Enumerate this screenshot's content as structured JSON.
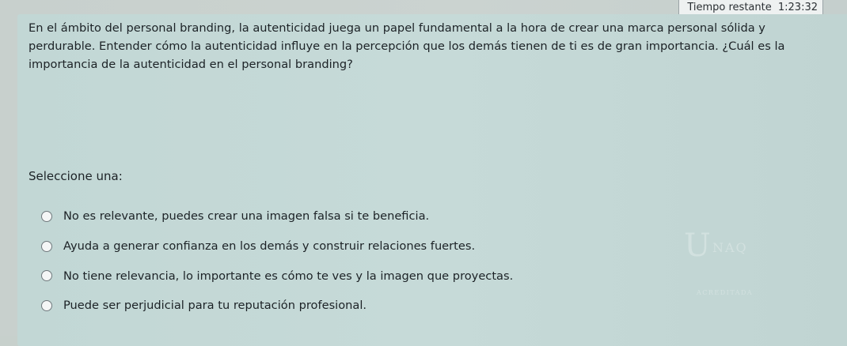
{
  "timer": {
    "label": "Tiempo restante",
    "value": "1:23:32"
  },
  "question": {
    "text": "En el ámbito del personal branding, la autenticidad juega un papel fundamental a la hora de crear una marca personal sólida y perdurable. Entender cómo la autenticidad influye en la percepción que los demás tienen de ti es de gran importancia. ¿Cuál es la importancia de la autenticidad en el personal branding?",
    "prompt": "Seleccione una:",
    "options": [
      {
        "label": "No es relevante, puedes crear una imagen falsa si te beneficia."
      },
      {
        "label": "Ayuda a generar confianza en los demás y construir relaciones fuertes."
      },
      {
        "label": "No tiene relevancia, lo importante es cómo te ves y la imagen que proyectas."
      },
      {
        "label": "Puede ser perjudicial para tu reputación profesional."
      }
    ]
  },
  "watermark": {
    "initial": "U",
    "name": "NAQ",
    "lower": "ACREDITADA"
  }
}
